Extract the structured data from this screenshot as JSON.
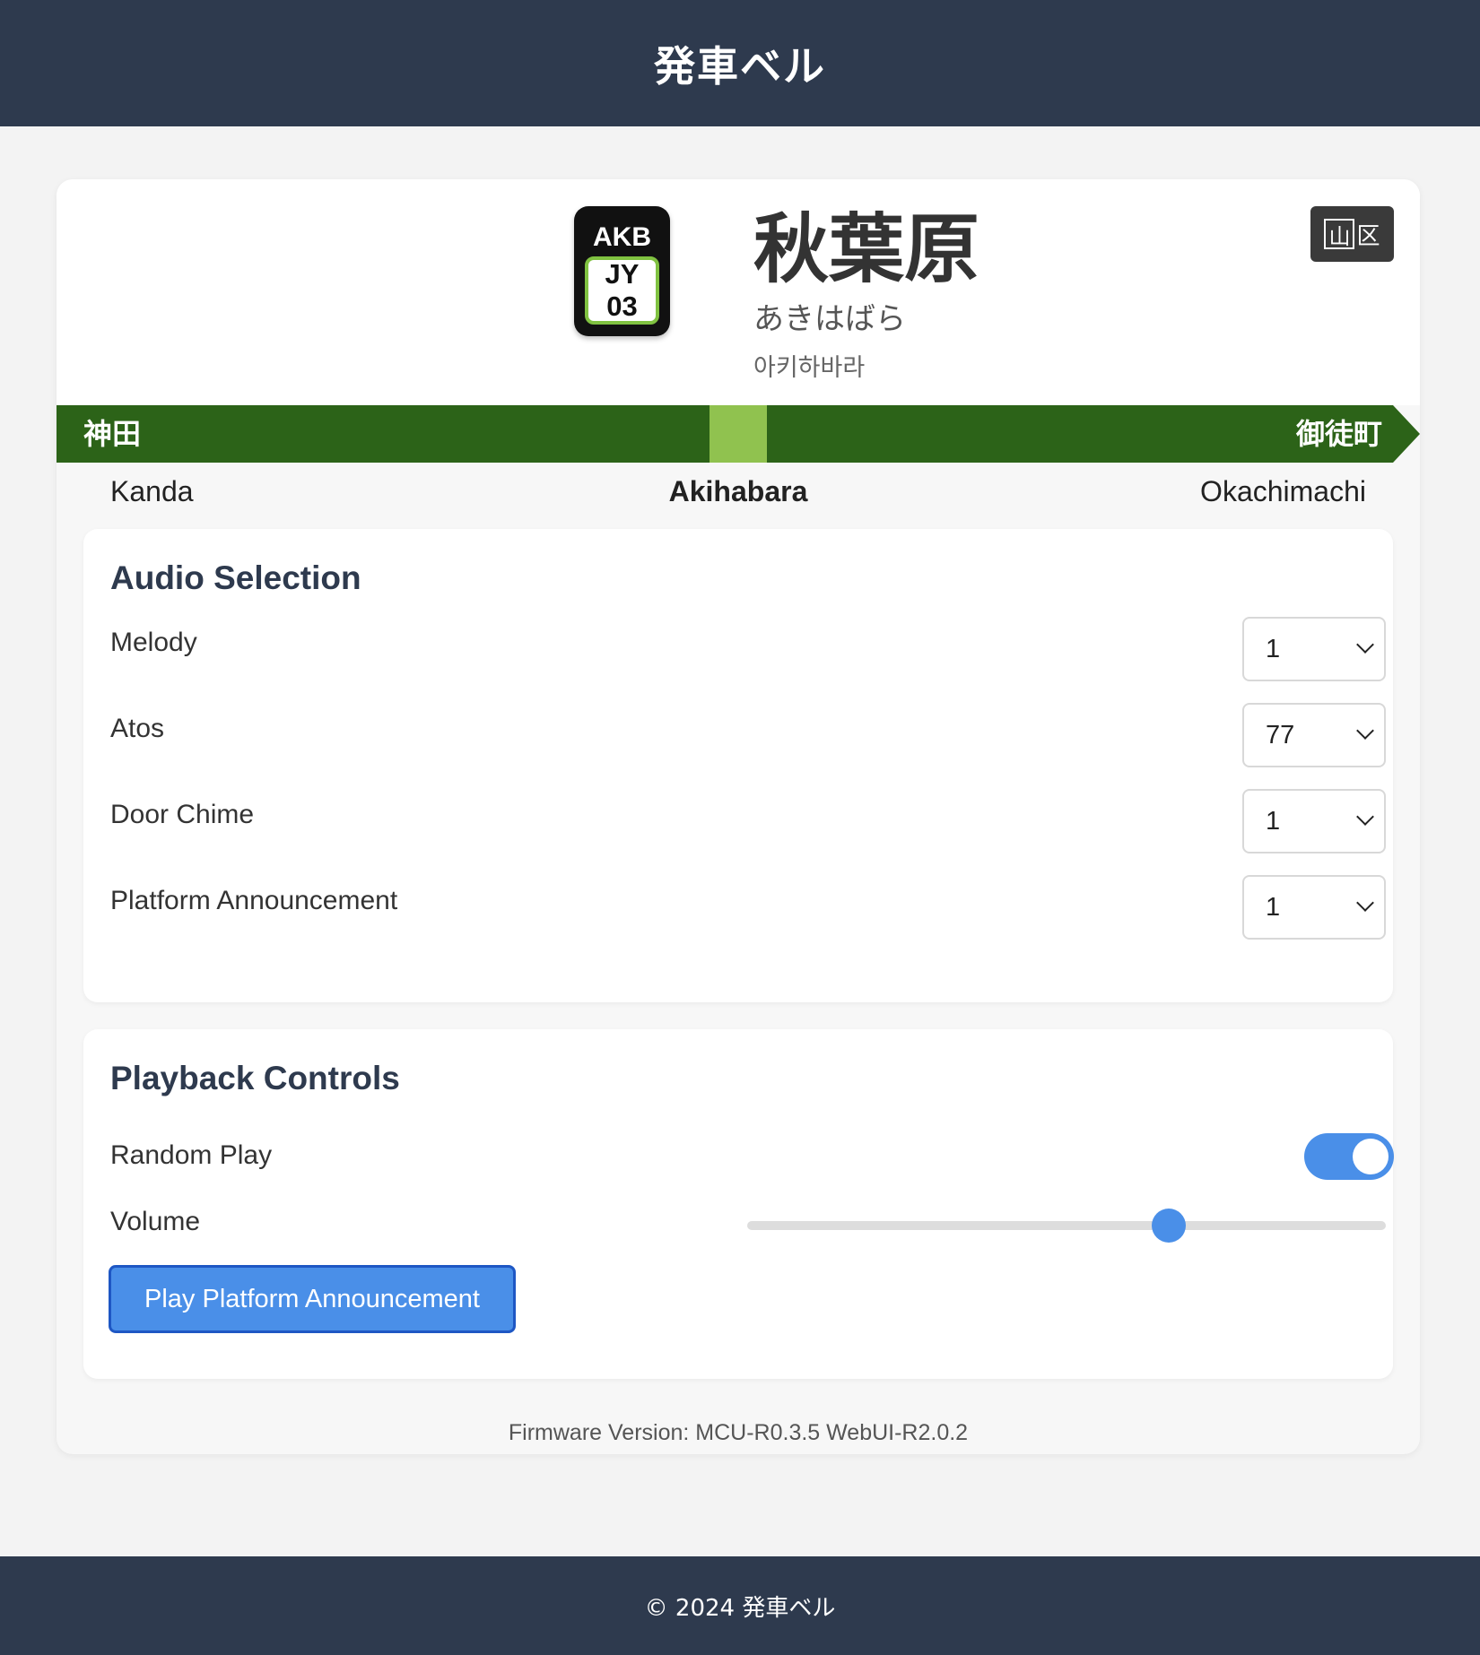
{
  "header": {
    "title": "発車ベル"
  },
  "station": {
    "badge": {
      "code": "AKB",
      "line": "JY",
      "number": "03"
    },
    "name": "秋葉原",
    "kana": "あきはばら",
    "korean": "아키하바라",
    "ward_badge": {
      "yama": "山",
      "ku": "区"
    }
  },
  "line": {
    "color": "#2c6318",
    "current_color": "#90c24f",
    "prev": {
      "kanji": "神田",
      "romaji": "Kanda"
    },
    "current": {
      "romaji": "Akihabara"
    },
    "next": {
      "kanji": "御徒町",
      "romaji": "Okachimachi"
    }
  },
  "audio_selection": {
    "title": "Audio Selection",
    "rows": [
      {
        "label": "Melody",
        "value": "1"
      },
      {
        "label": "Atos",
        "value": "77"
      },
      {
        "label": "Door Chime",
        "value": "1"
      },
      {
        "label": "Platform Announcement",
        "value": "1"
      }
    ]
  },
  "playback": {
    "title": "Playback Controls",
    "random_play_label": "Random Play",
    "random_play_on": true,
    "volume_label": "Volume",
    "volume": 0.66,
    "play_button": "Play Platform Announcement",
    "accent": "#4a8fe8"
  },
  "firmware": "Firmware Version: MCU-R0.3.5 WebUI-R2.0.2",
  "footer": {
    "copyright": "© 2024 発車ベル"
  }
}
